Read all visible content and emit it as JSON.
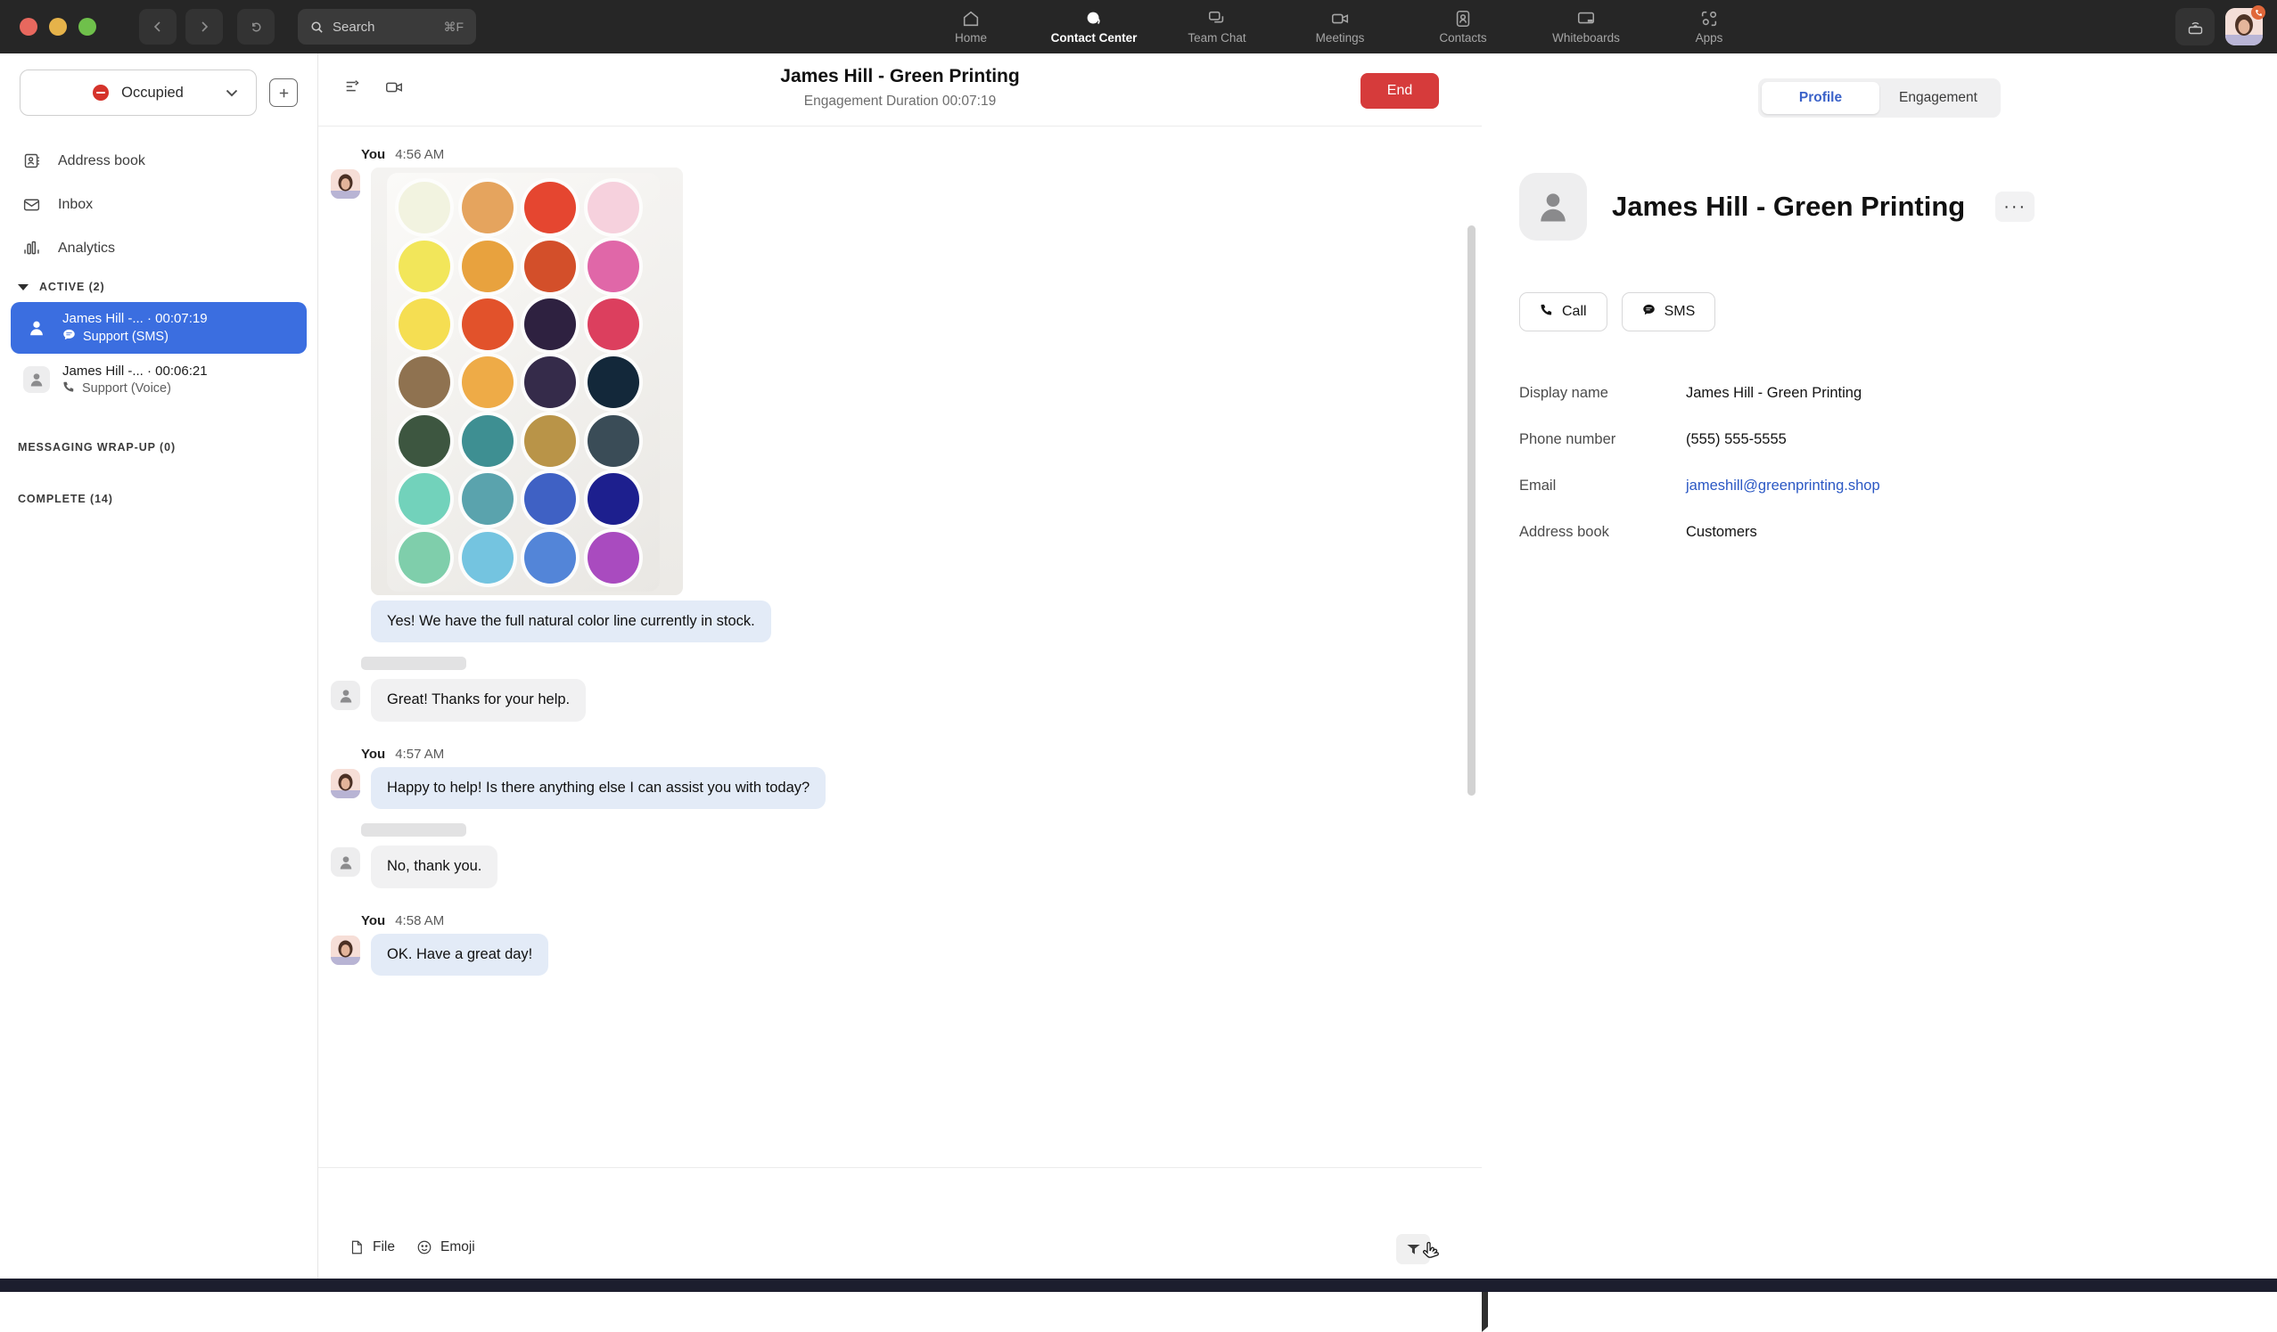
{
  "topbar": {
    "search": {
      "label": "Search",
      "shortcut": "⌘F"
    },
    "nav": [
      {
        "label": "Home",
        "icon": "home-icon",
        "active": false
      },
      {
        "label": "Contact Center",
        "icon": "contact-center-icon",
        "active": true
      },
      {
        "label": "Team Chat",
        "icon": "team-chat-icon",
        "active": false
      },
      {
        "label": "Meetings",
        "icon": "meetings-icon",
        "active": false
      },
      {
        "label": "Contacts",
        "icon": "contacts-icon",
        "active": false
      },
      {
        "label": "Whiteboards",
        "icon": "whiteboards-icon",
        "active": false
      },
      {
        "label": "Apps",
        "icon": "apps-icon",
        "active": false
      }
    ]
  },
  "sidebar": {
    "status": {
      "label": "Occupied",
      "color": "#d5332b"
    },
    "nav_items": [
      {
        "label": "Address book",
        "icon": "address-book-icon"
      },
      {
        "label": "Inbox",
        "icon": "inbox-icon"
      },
      {
        "label": "Analytics",
        "icon": "analytics-icon"
      }
    ],
    "sections": [
      {
        "label": "ACTIVE (2)",
        "expanded": true
      },
      {
        "label": "MESSAGING WRAP-UP (0)",
        "expanded": false
      },
      {
        "label": "COMPLETE (14)",
        "expanded": false
      }
    ],
    "engagements": [
      {
        "title": "James Hill -... · 00:07:19",
        "queue": "Support (SMS)",
        "channel_icon": "sms-icon",
        "selected": true
      },
      {
        "title": "James Hill -... · 00:06:21",
        "queue": "Support (Voice)",
        "channel_icon": "phone-icon",
        "selected": false
      }
    ]
  },
  "chat": {
    "title": "James Hill - Green Printing",
    "subtitle": "Engagement Duration 00:07:19",
    "end_label": "End",
    "header_icons": [
      "transfer-icon",
      "video-icon"
    ],
    "messages": [
      {
        "type": "meta",
        "who": "You",
        "time": "4:56 AM"
      },
      {
        "type": "image",
        "side": "out",
        "alt": "watercolor paint palette"
      },
      {
        "type": "text",
        "side": "out",
        "text": "Yes! We have the full natural color line currently in stock."
      },
      {
        "type": "redacted",
        "width": 118
      },
      {
        "type": "text",
        "side": "in",
        "text": "Great! Thanks for your help."
      },
      {
        "type": "meta",
        "who": "You",
        "time": "4:57 AM"
      },
      {
        "type": "text",
        "side": "out",
        "text": "Happy to help! Is there anything else I can assist you with today?"
      },
      {
        "type": "redacted",
        "width": 118
      },
      {
        "type": "text",
        "side": "in",
        "text": "No, thank you."
      },
      {
        "type": "meta",
        "who": "You",
        "time": "4:58 AM"
      },
      {
        "type": "text",
        "side": "out",
        "text": "OK. Have a great day!"
      }
    ],
    "composer": {
      "file_label": "File",
      "emoji_label": "Emoji",
      "send_icon": "send-icon"
    }
  },
  "palette_colors": [
    "#f2f3e0",
    "#e5a45e",
    "#e54630",
    "#f6d1dd",
    "#f2e65a",
    "#e8a23e",
    "#d34f2a",
    "#e067a8",
    "#f5de52",
    "#e2522b",
    "#2e2140",
    "#dc3f5e",
    "#8f7250",
    "#eeab47",
    "#352b4a",
    "#13283a",
    "#3d5640",
    "#3e8f92",
    "#b99448",
    "#3a4c57",
    "#72d2bb",
    "#5aa3ad",
    "#3f61c4",
    "#1d1f8e",
    "#7fceab",
    "#74c4e0",
    "#5385d8",
    "#a94bbf"
  ],
  "right_panel": {
    "tabs": [
      {
        "label": "Profile",
        "active": true
      },
      {
        "label": "Engagement",
        "active": false
      }
    ],
    "name": "James Hill - Green Printing",
    "more_label": "···",
    "actions": [
      {
        "label": "Call",
        "icon": "phone-icon"
      },
      {
        "label": "SMS",
        "icon": "sms-icon"
      }
    ],
    "fields": [
      {
        "label": "Display name",
        "value": "James Hill - Green Printing",
        "link": false
      },
      {
        "label": "Phone number",
        "value": "(555) 555-5555",
        "link": false
      },
      {
        "label": "Email",
        "value": "jameshill@greenprinting.shop",
        "link": true
      },
      {
        "label": "Address book",
        "value": "Customers",
        "link": false
      }
    ]
  }
}
